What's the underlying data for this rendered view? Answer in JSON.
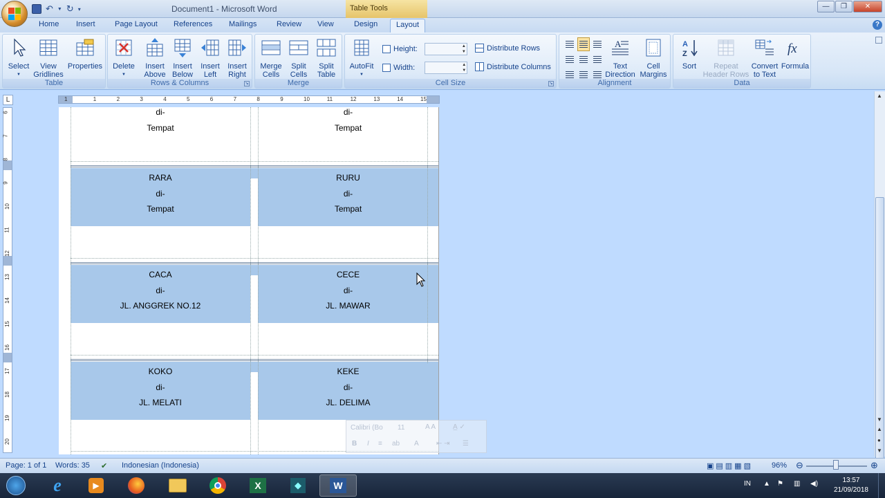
{
  "window": {
    "title": "Document1 - Microsoft Word",
    "contextual_tab_group": "Table Tools",
    "controls": [
      "minimize",
      "restore",
      "close"
    ]
  },
  "tabs": {
    "home": "Home",
    "insert": "Insert",
    "page_layout": "Page Layout",
    "references": "References",
    "mailings": "Mailings",
    "review": "Review",
    "view": "View",
    "design": "Design",
    "layout": "Layout",
    "active": "Layout"
  },
  "ribbon": {
    "table": {
      "label": "Table",
      "select": "Select",
      "view_gridlines_1": "View",
      "view_gridlines_2": "Gridlines",
      "properties": "Properties"
    },
    "rows_columns": {
      "label": "Rows & Columns",
      "delete": "Delete",
      "insert_above_1": "Insert",
      "insert_above_2": "Above",
      "insert_below_1": "Insert",
      "insert_below_2": "Below",
      "insert_left_1": "Insert",
      "insert_left_2": "Left",
      "insert_right_1": "Insert",
      "insert_right_2": "Right"
    },
    "merge": {
      "label": "Merge",
      "merge_cells_1": "Merge",
      "merge_cells_2": "Cells",
      "split_cells_1": "Split",
      "split_cells_2": "Cells",
      "split_table_1": "Split",
      "split_table_2": "Table"
    },
    "cell_size": {
      "label": "Cell Size",
      "autofit": "AutoFit",
      "height": "Height:",
      "width": "Width:",
      "height_value": "",
      "width_value": "",
      "distribute_rows": "Distribute Rows",
      "distribute_columns": "Distribute Columns"
    },
    "alignment": {
      "label": "Alignment",
      "text_direction_1": "Text",
      "text_direction_2": "Direction",
      "cell_margins_1": "Cell",
      "cell_margins_2": "Margins"
    },
    "data": {
      "label": "Data",
      "sort": "Sort",
      "repeat_header_1": "Repeat",
      "repeat_header_2": "Header Rows",
      "convert_1": "Convert",
      "convert_2": "to Text",
      "formula": "Formula"
    }
  },
  "ruler": {
    "tab_selector": "L",
    "h_numbers": [
      "1",
      "1",
      "2",
      "3",
      "4",
      "5",
      "6",
      "7",
      "8",
      "9",
      "10",
      "11",
      "12",
      "13",
      "14",
      "15"
    ],
    "v_numbers": [
      "6",
      "7",
      "8",
      "9",
      "10",
      "11",
      "12",
      "13",
      "14",
      "15",
      "16",
      "17",
      "18",
      "19",
      "20"
    ]
  },
  "document": {
    "rows": [
      {
        "selected": false,
        "left": [
          "",
          "di-",
          "Tempat"
        ],
        "right": [
          "",
          "di-",
          "Tempat"
        ]
      },
      {
        "selected": true,
        "left": [
          "RARA",
          "di-",
          "Tempat"
        ],
        "right": [
          "RURU",
          "di-",
          "Tempat"
        ]
      },
      {
        "selected": true,
        "left": [
          "CACA",
          "di-",
          "JL. ANGGREK NO.12"
        ],
        "right": [
          "CECE",
          "di-",
          "JL. MAWAR"
        ]
      },
      {
        "selected": true,
        "left": [
          "KOKO",
          "di-",
          "JL. MELATI"
        ],
        "right": [
          "KEKE",
          "di-",
          "JL. DELIMA"
        ]
      }
    ]
  },
  "mini_toolbar": {
    "font": "Calibri (Bo",
    "size": "11"
  },
  "statusbar": {
    "page": "Page: 1 of 1",
    "words": "Words: 35",
    "language": "Indonesian (Indonesia)",
    "zoom": "96%"
  },
  "taskbar": {
    "language": "IN",
    "time": "13:57",
    "date": "21/09/2018",
    "apps": [
      "start-button",
      "internet-explorer-icon",
      "media-player-icon",
      "firefox-icon",
      "file-explorer-icon",
      "chrome-icon",
      "excel-icon",
      "filmora-icon",
      "word-icon"
    ]
  },
  "colors": {
    "selection": "#a8c8ea",
    "ribbon": "#d7e6f7",
    "workspace": "#bfdbff",
    "table_tools": "#e6c46a",
    "text_blue": "#15428b"
  }
}
